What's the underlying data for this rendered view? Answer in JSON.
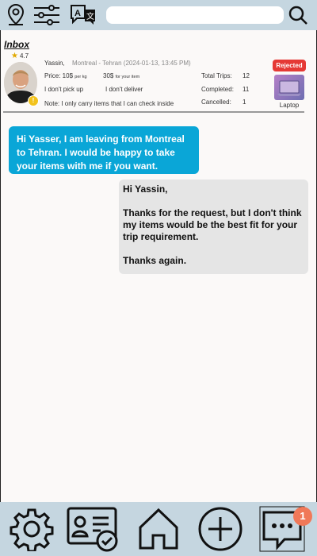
{
  "header": {
    "search_placeholder": "",
    "icons": [
      "location-pin-icon",
      "filters-icon",
      "translate-icon",
      "search-icon"
    ]
  },
  "inbox_title": "Inbox",
  "request": {
    "rating": "4.7",
    "badge": "!",
    "name": "Yassin,",
    "route": "Montreal - Tehran (2024-01-13, 13:45 PM)",
    "price": "Price: 10$",
    "price_unit": "per kg",
    "item_price": "30$",
    "item_price_unit": "for your item",
    "pickup": "I don't pick up",
    "deliver": "I don't deliver",
    "note": "Note: I only carry items that I can check inside",
    "stats": {
      "total_trips_label": "Total Trips:",
      "total_trips": "12",
      "completed_label": "Completed:",
      "completed": "11",
      "cancelled_label": "Cancelled:",
      "cancelled": "1"
    },
    "status": "Rejected",
    "status_color": "#e53935",
    "item_label": "Laptop"
  },
  "messages": [
    {
      "from": "traveler",
      "text": "Hi Yasser,  I am leaving from Montreal to Tehran. I would be happy to take your items with me if you want."
    },
    {
      "from": "me",
      "text": "Hi Yassin,\n\nThanks for the request,  but I don't think my items would be the best fit for your trip requirement.\n\nThanks again."
    }
  ],
  "bottom_nav": {
    "items": [
      "settings-icon",
      "profile-card-icon",
      "home-icon",
      "add-icon",
      "messages-icon"
    ],
    "messages_badge": "1"
  },
  "colors": {
    "bar": "#c5d6e0",
    "incoming_bubble": "#0aa6d7",
    "outgoing_bubble": "#e5e5e5",
    "badge": "#f07858"
  }
}
